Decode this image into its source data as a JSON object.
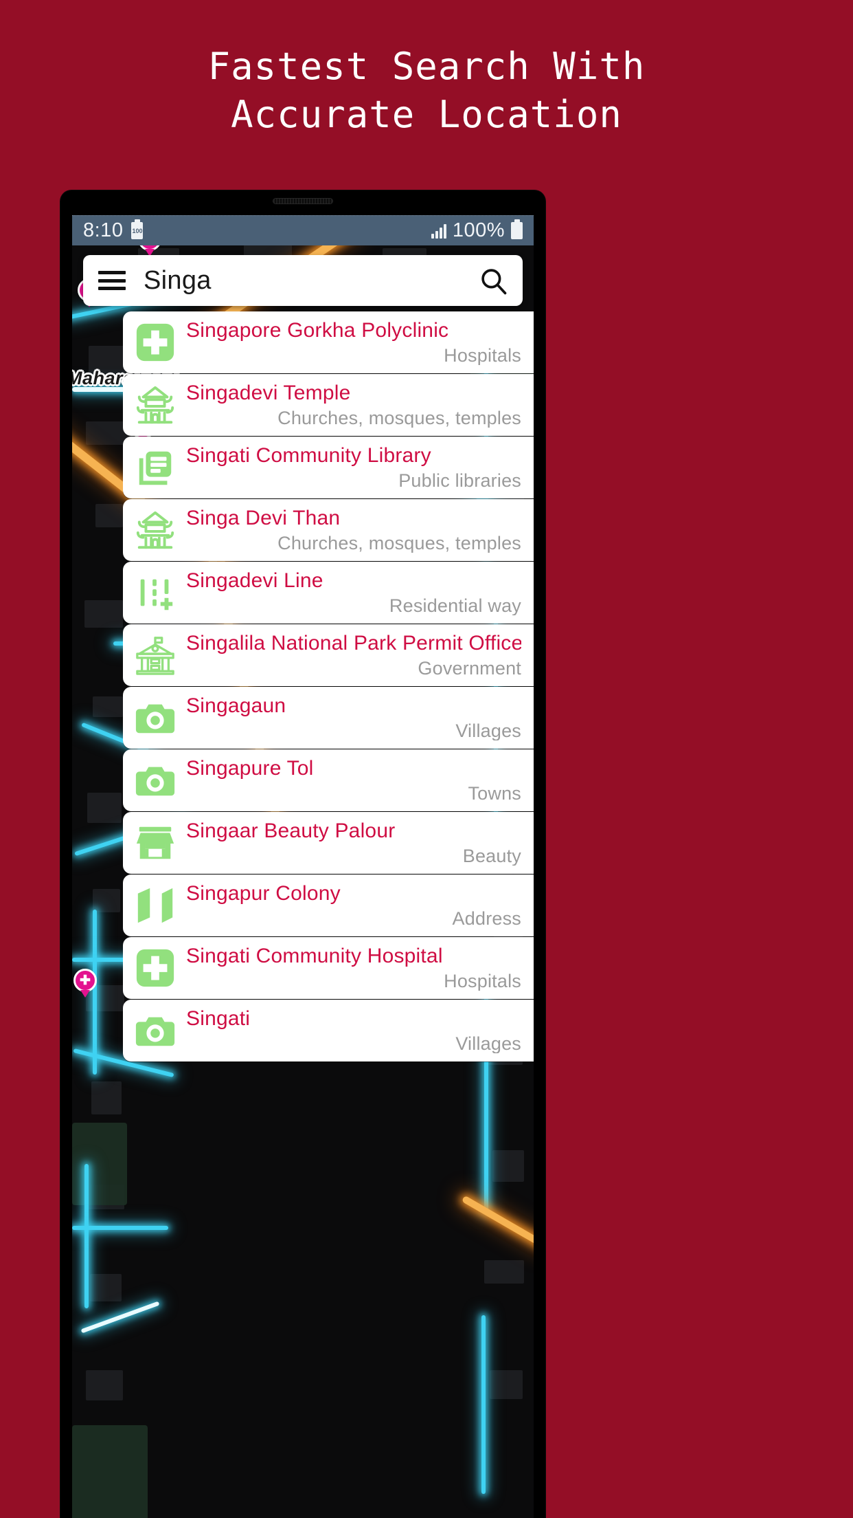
{
  "promo": {
    "headline_line1": "Fastest Search With",
    "headline_line2": "Accurate Location",
    "background_color": "#940e26",
    "headline_color": "#ffffff"
  },
  "status_bar": {
    "time": "8:10",
    "battery_label": "100",
    "battery_percent": "100%",
    "background_color": "#4a6076"
  },
  "search": {
    "query": "Singa",
    "menu_icon": "hamburger-menu-icon",
    "search_icon": "search-icon"
  },
  "map": {
    "label": "Maharajganj",
    "style": "dark-neon",
    "road_color": "#3fd2f2",
    "highway_color": "#f6b352",
    "poi_color": "#e3128f"
  },
  "theme": {
    "title_color": "#cf0d43",
    "subtitle_color": "#9a9a9a",
    "icon_green": "#92e07e"
  },
  "results": [
    {
      "title": "Singapore Gorkha Polyclinic",
      "category": "Hospitals",
      "icon": "hospital-cross-icon"
    },
    {
      "title": "Singadevi Temple",
      "category": "Churches, mosques, temples",
      "icon": "temple-icon"
    },
    {
      "title": "Singati Community Library",
      "category": "Public libraries",
      "icon": "library-books-icon"
    },
    {
      "title": "Singa Devi Than",
      "category": "Churches, mosques, temples",
      "icon": "temple-icon"
    },
    {
      "title": "Singadevi Line",
      "category": "Residential way",
      "icon": "road-way-icon"
    },
    {
      "title": "Singalila National Park Permit Office",
      "category": "Government",
      "icon": "government-building-icon"
    },
    {
      "title": "Singagaun",
      "category": "Villages",
      "icon": "camera-icon"
    },
    {
      "title": "Singapure Tol",
      "category": "Towns",
      "icon": "camera-icon"
    },
    {
      "title": "Singaar Beauty Palour",
      "category": "Beauty",
      "icon": "shop-store-icon"
    },
    {
      "title": "Singapur Colony",
      "category": "Address",
      "icon": "folded-map-icon"
    },
    {
      "title": "Singati Community Hospital",
      "category": "Hospitals",
      "icon": "hospital-cross-icon"
    },
    {
      "title": "Singati",
      "category": "Villages",
      "icon": "camera-icon"
    }
  ]
}
